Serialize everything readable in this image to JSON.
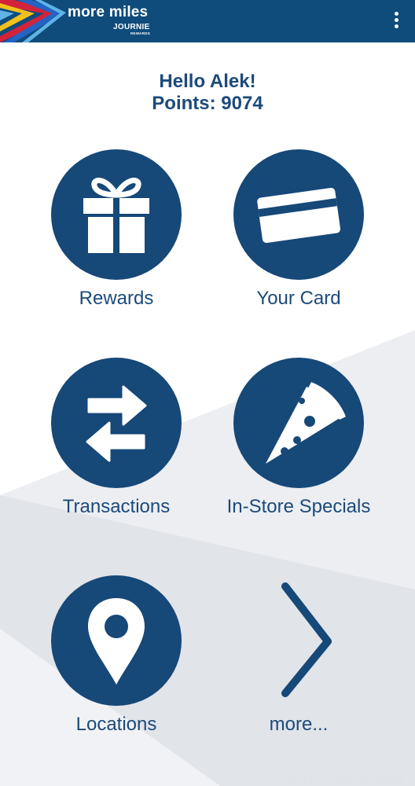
{
  "app": {
    "brand_main": "more miles",
    "brand_sub": "JOURNIE",
    "brand_sub2": "REWARDS"
  },
  "greeting": {
    "hello": "Hello Alek!",
    "points": "Points: 9074"
  },
  "tiles": [
    {
      "label": "Rewards",
      "icon": "gift-icon"
    },
    {
      "label": "Your Card",
      "icon": "card-icon"
    },
    {
      "label": "Transactions",
      "icon": "transfer-arrows-icon"
    },
    {
      "label": "In-Store Specials",
      "icon": "pizza-icon"
    },
    {
      "label": "Locations",
      "icon": "location-pin-icon"
    },
    {
      "label": "more...",
      "icon": "chevron-right-icon"
    }
  ],
  "footer": "Ver: 4.1.1 - Powered by MIDAX",
  "colors": {
    "header": "#0f4c7b",
    "circle": "#164878",
    "text": "#1c4a7a",
    "stripe_red": "#d3233a",
    "stripe_yellow": "#f3c01b",
    "stripe_lightblue": "#5fb4e6",
    "stripe_blue": "#2463c4"
  }
}
